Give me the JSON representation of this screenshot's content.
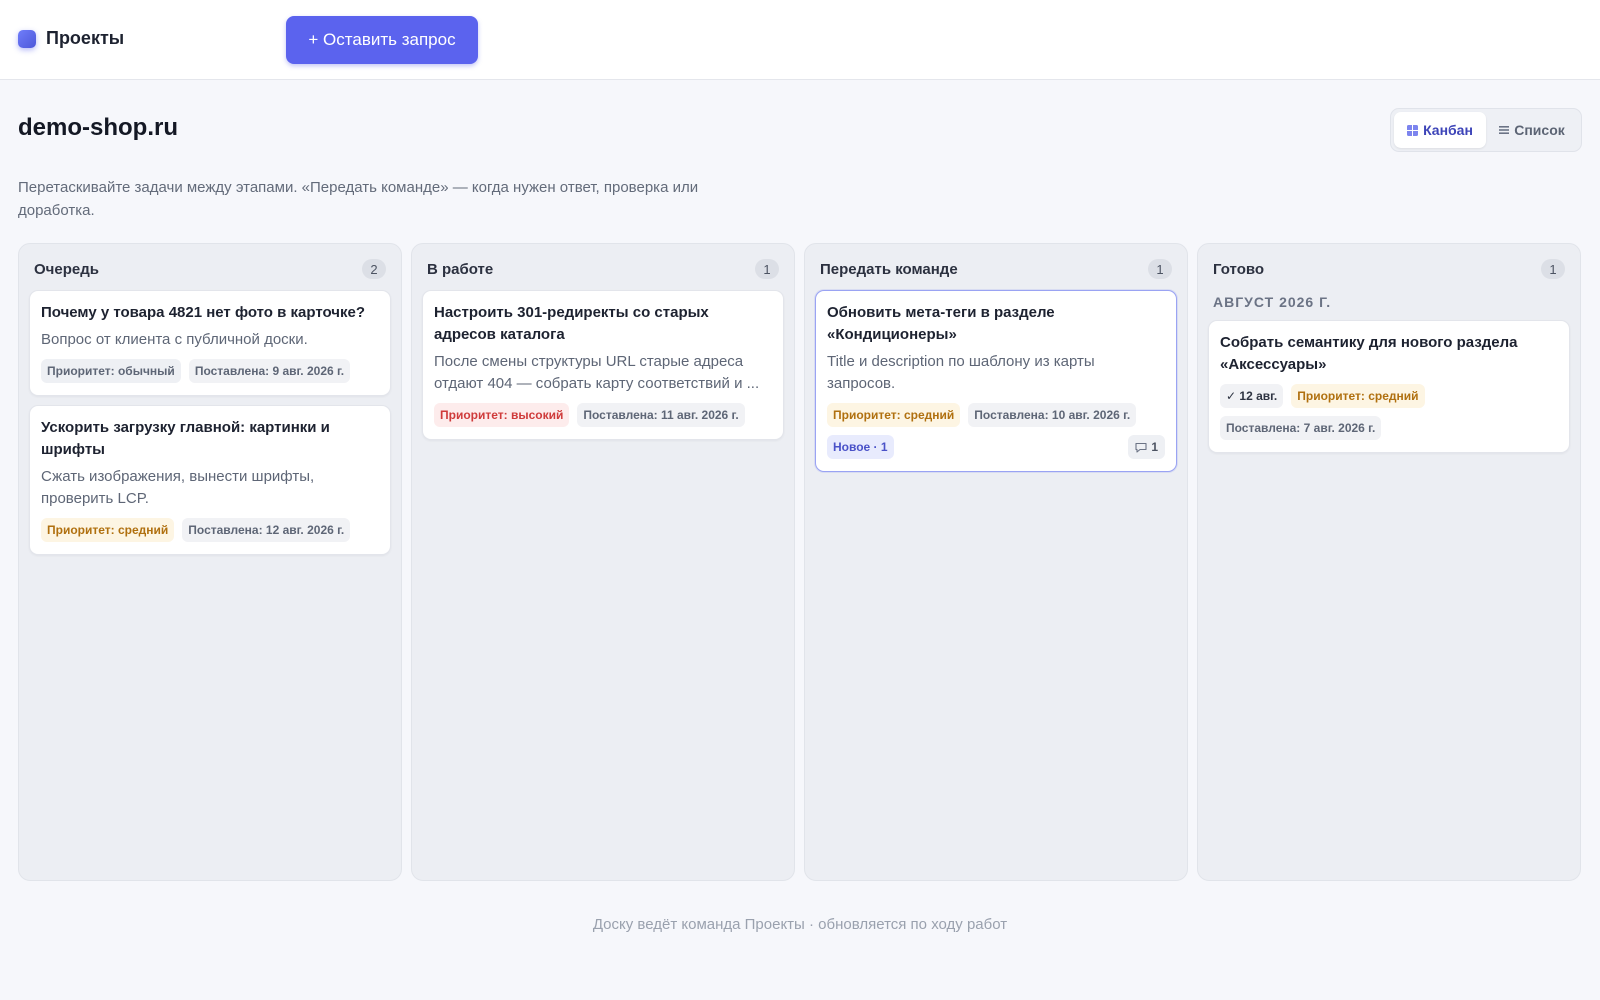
{
  "header": {
    "brand": "Проекты",
    "request_button": "+ Оставить запрос"
  },
  "page": {
    "title": "demo-shop.ru",
    "description": "Перетаскивайте задачи между этапами. «Передать команде» — когда нужен ответ, проверка или доработка.",
    "view_toggle": {
      "kanban": "Канбан",
      "list": "Список",
      "active": "kanban"
    }
  },
  "columns": [
    {
      "title": "Очередь",
      "count": "2",
      "cards": [
        {
          "title": "Почему у товара 4821 нет фото в карточке?",
          "desc": "Вопрос от клиента с публичной доски.",
          "priority": "Приоритет: обычный",
          "posted": "Поставлена: 9 авг. 2026 г."
        },
        {
          "title": "Ускорить загрузку главной: картинки и шрифты",
          "desc": "Сжать изображения, вынести шрифты, проверить LCP.",
          "priority": "Приоритет: средний",
          "posted": "Поставлена: 12 авг. 2026 г."
        }
      ]
    },
    {
      "title": "В работе",
      "count": "1",
      "cards": [
        {
          "title": "Настроить 301-редиректы со старых адресов каталога",
          "desc": "После смены структуры URL старые адреса отдают 404 — собрать карту соответствий и ...",
          "priority": "Приоритет: высокий",
          "posted": "Поставлена: 11 авг. 2026 г."
        }
      ]
    },
    {
      "title": "Передать команде",
      "count": "1",
      "cards": [
        {
          "title": "Обновить мета-теги в разделе «Кондиционеры»",
          "desc": "Title и description по шаблону из карты запросов.",
          "priority": "Приоритет: средний",
          "posted": "Поставлена: 10 авг. 2026 г.",
          "status": "Новое · 1",
          "comments": "1"
        }
      ]
    },
    {
      "title": "Готово",
      "count": "1",
      "month": "АВГУСТ 2026 Г.",
      "cards": [
        {
          "title": "Собрать семантику для нового раздела «Аксессуары»",
          "done": "✓ 12 авг.",
          "priority": "Приоритет: средний",
          "posted": "Поставлена: 7 авг. 2026 г."
        }
      ]
    }
  ],
  "footer": "Доску ведёт команда Проекты · обновляется по ходу работ",
  "colors": {
    "accent": "#5b63ee",
    "priority_high": "#cf3b3b",
    "priority_medium": "#b0700f",
    "priority_normal": "#5e6676"
  },
  "icons": {
    "brand": "app-logo-icon",
    "kanban": "grid-icon",
    "list": "list-icon",
    "comment": "comment-icon"
  }
}
